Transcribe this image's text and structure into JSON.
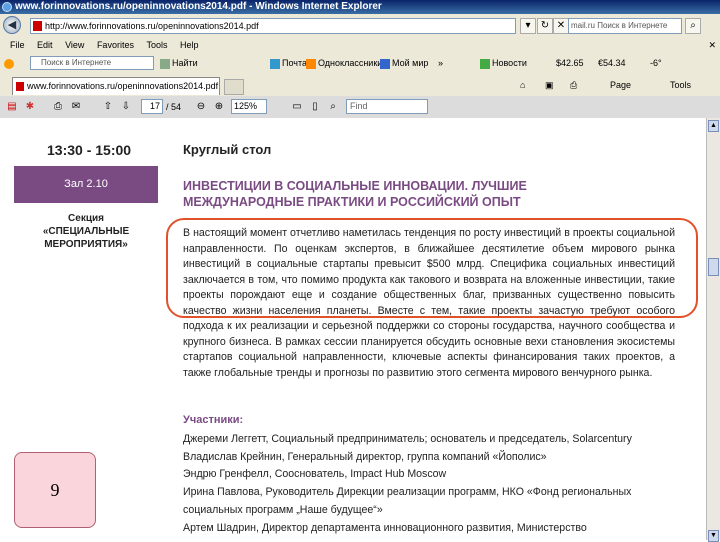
{
  "window": {
    "title": "www.forinnovations.ru/openinnovations2014.pdf - Windows Internet Explorer"
  },
  "address_bar": {
    "url": "http://www.forinnovations.ru/openinnovations2014.pdf",
    "search_placeholder": "mail.ru Поиск в Интернете"
  },
  "menu": {
    "items": [
      "File",
      "Edit",
      "View",
      "Favorites",
      "Tools",
      "Help"
    ]
  },
  "links_bar": {
    "search_placeholder": "Поиск в Интернете",
    "find_label": "Найти",
    "mail_label": "Почта",
    "classmates_label": "Одноклассники",
    "myworld_label": "Мой мир",
    "more": "»",
    "news_label": "Новости",
    "usd": "$42.65",
    "eur": "€54.34",
    "temp": "-6°"
  },
  "tab": {
    "label": "www.forinnovations.ru/openinnovations2014.pdf"
  },
  "page_tools": {
    "page": "Page",
    "tools": "Tools"
  },
  "pdf_toolbar": {
    "page_current": "17",
    "page_total": "/ 54",
    "zoom": "125%",
    "find_placeholder": "Find"
  },
  "document": {
    "time": "13:30 - 15:00",
    "hall": "Зал 2.10",
    "section_lines": [
      "Секция",
      "«СПЕЦИАЛЬНЫЕ",
      "МЕРОПРИЯТИЯ»"
    ],
    "round_table": "Круглый стол",
    "heading_lines": [
      "ИНВЕСТИЦИИ В СОЦИАЛЬНЫЕ ИННОВАЦИИ. ЛУЧШИЕ",
      "МЕЖДУНАРОДНЫЕ ПРАКТИКИ И РОССИЙСКИЙ ОПЫТ"
    ],
    "body": "В настоящий момент отчетливо наметилась тенденция по росту инвестиций в проекты социальной направленности. По оценкам экспертов, в ближайшее десятилетие объем мирового рынка инвестиций в социальные стартапы превысит $500 млрд. Специфика социальных инвестиций заключается в том, что помимо продукта как такового и возврата на вложенные инвестиции, такие проекты порождают еще и создание общественных благ, призванных существенно повысить качество жизни населения планеты. Вместе с тем, такие проекты зачастую требуют особого подхода к их реализации и серьезной поддержки со стороны государства, научного сообщества и крупного бизнеса. В рамках сессии планируется обсудить основные вехи становления экосистемы стартапов социальной направленности, ключевые аспекты финансирования таких проектов, а также глобальные тренды и прогнозы по развитию этого сегмента мирового венчурного рынка.",
    "participants_heading": "Участники:",
    "participants": [
      "Джереми Леггетт, Социальный предприниматель; основатель и председатель, Solarcentury",
      "Владислав Крейнин, Генеральный директор, группа компаний «Йополис»",
      "Эндрю Гренфелл, Сооснователь, Impact Hub Moscow",
      "Ирина Павлова, Руководитель Дирекции реализации программ, НКО «Фонд региональных",
      "социальных программ „Наше будущее“»",
      "Артем Шадрин, Директор департамента инновационного развития, Министерство"
    ]
  },
  "slide_number": "9",
  "colors": {
    "accent_purple": "#7a4b83",
    "highlight_oval": "#e2522a",
    "slide_badge": "#fbd5dc"
  }
}
